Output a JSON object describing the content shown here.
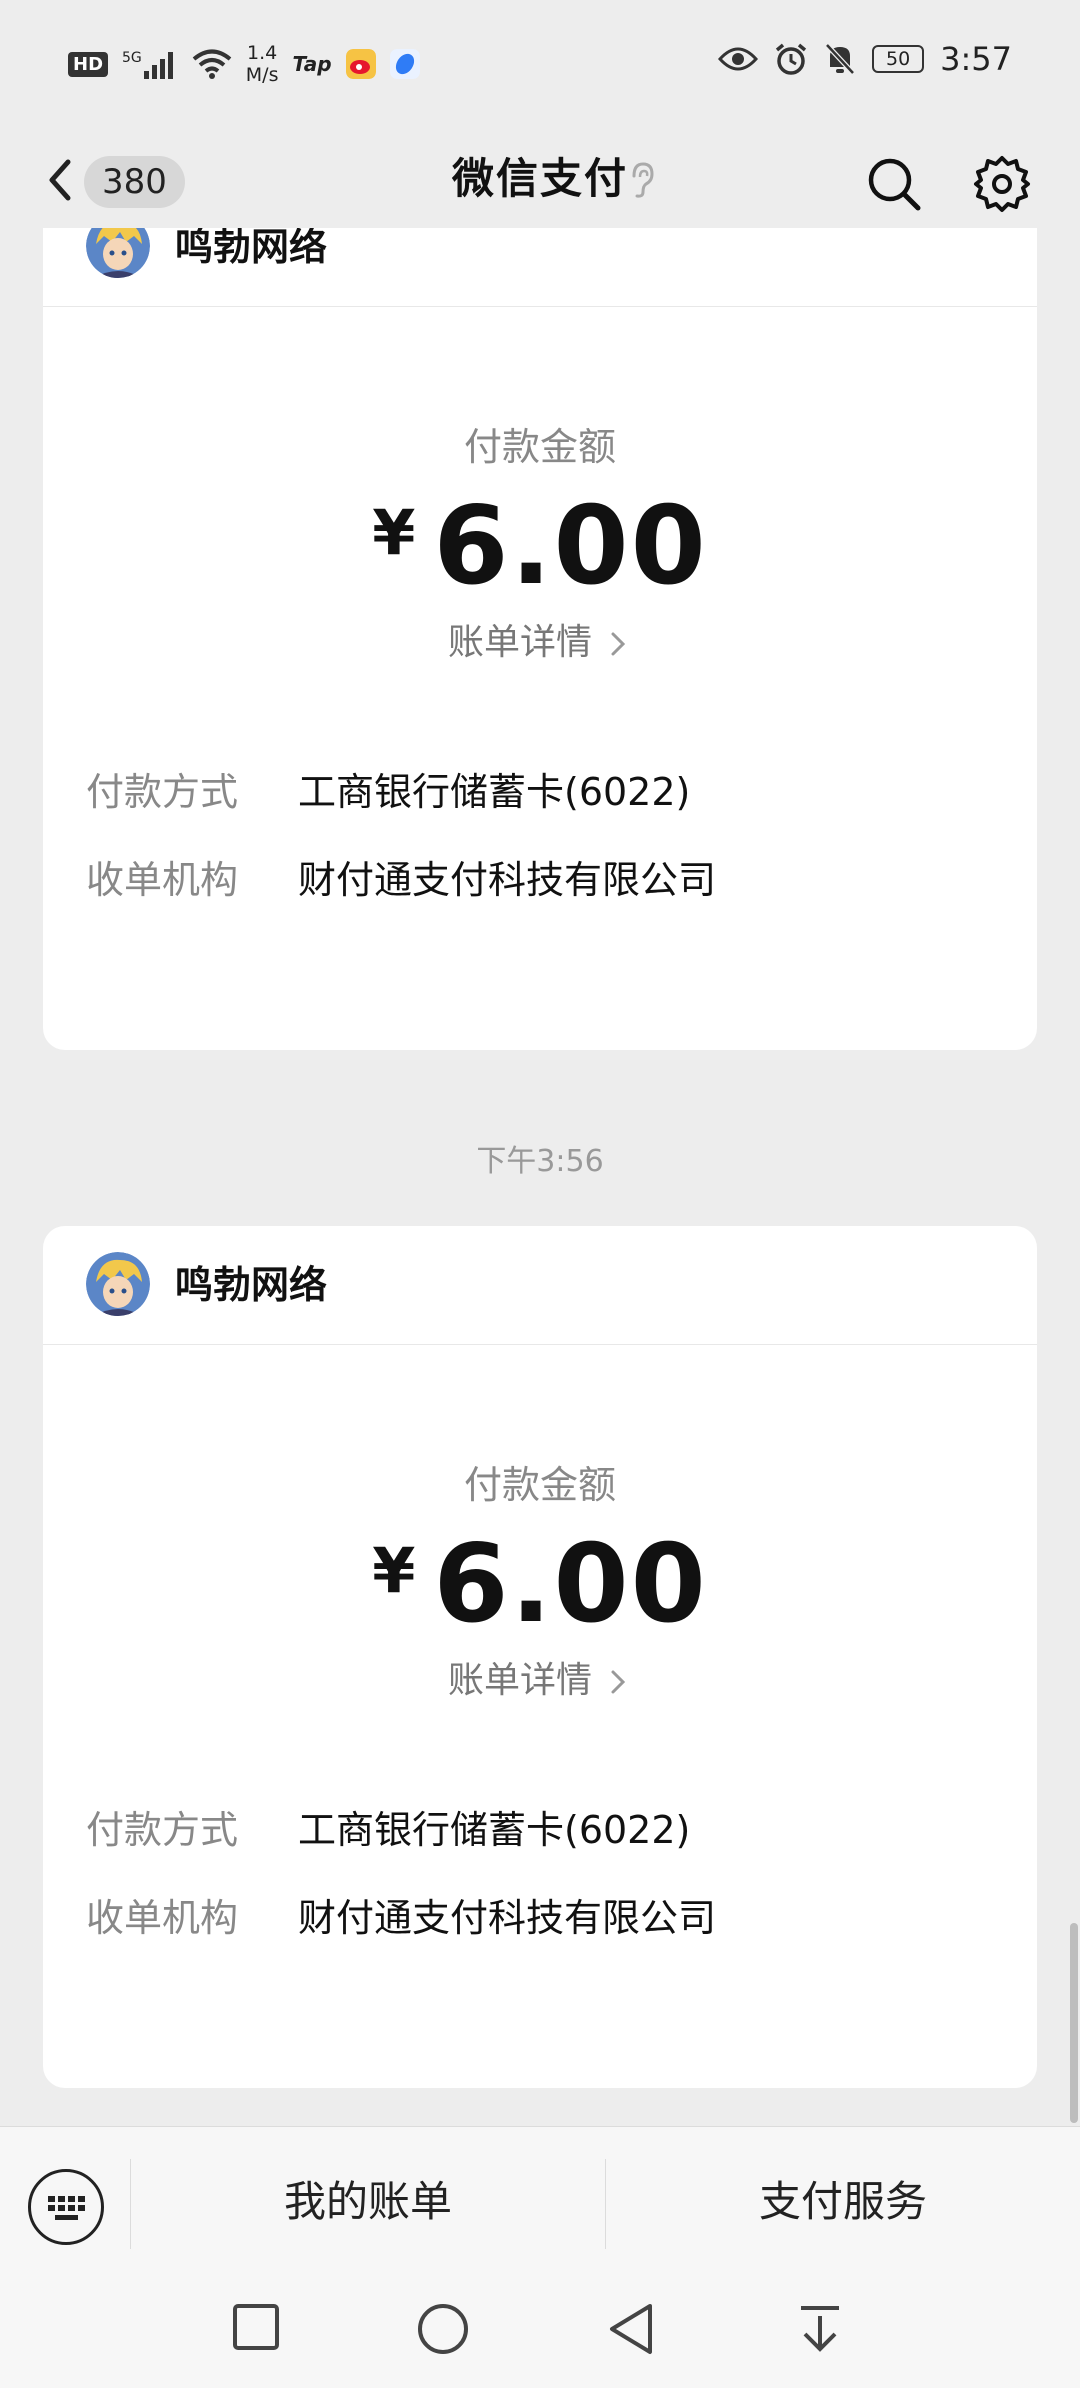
{
  "status_bar": {
    "hd": "HD",
    "network": "5G",
    "speed_value": "1.4",
    "speed_unit": "M/s",
    "tap": "Tap",
    "battery": "50",
    "time": "3:57"
  },
  "header": {
    "unread_count": "380",
    "title": "微信支付"
  },
  "cards": [
    {
      "merchant": "鸣勃网络",
      "amount_label": "付款金额",
      "currency": "¥",
      "amount": "6.00",
      "detail_link": "账单详情",
      "payment_method_label": "付款方式",
      "payment_method": "工商银行储蓄卡(6022)",
      "acquirer_label": "收单机构",
      "acquirer": "财付通支付科技有限公司"
    },
    {
      "merchant": "鸣勃网络",
      "amount_label": "付款金额",
      "currency": "¥",
      "amount": "6.00",
      "detail_link": "账单详情",
      "payment_method_label": "付款方式",
      "payment_method": "工商银行储蓄卡(6022)",
      "acquirer_label": "收单机构",
      "acquirer": "财付通支付科技有限公司"
    }
  ],
  "timestamp": "下午3:56",
  "bottom_menu": {
    "my_bills": "我的账单",
    "payment_services": "支付服务"
  },
  "colors": {
    "background": "#ededed",
    "card": "#ffffff",
    "muted_text": "#888888"
  }
}
